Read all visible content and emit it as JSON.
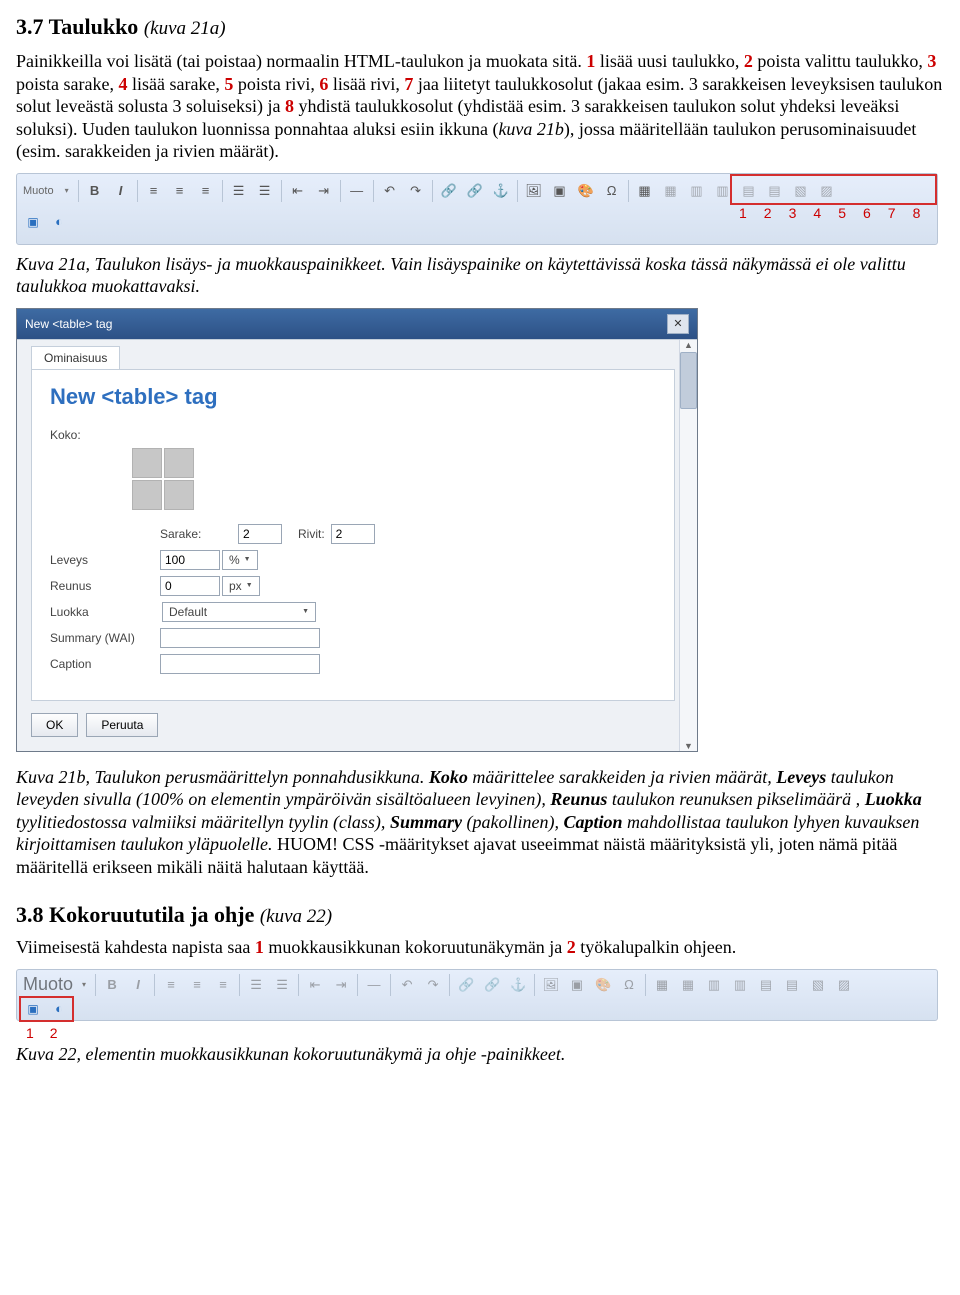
{
  "section37": {
    "title": "3.7 Taulukko",
    "kuva": "(kuva 21a)",
    "p1a": "Painikkeilla voi lisätä (tai poistaa) normaalin HTML-taulukon ja muokata sitä. ",
    "p1_1": "1",
    "p1_1t": " lisää uusi taulukko, ",
    "p1_2": "2",
    "p1_2t": " poista valittu taulukko, ",
    "p1_3": "3",
    "p1_3t": " poista sarake, ",
    "p1_4": "4",
    "p1_4t": " lisää sarake, ",
    "p1_5": "5",
    "p1_5t": " poista rivi, ",
    "p1_6": "6",
    "p1_6t": " lisää rivi, ",
    "p1_7": "7",
    "p1_7t": " jaa liitetyt taulukkosolut (jakaa esim. 3 sarakkeisen leveyksisen taulukon solut leveästä solusta 3 soluiseksi) ja ",
    "p1_8": "8",
    "p1_8t": " yhdistä taulukkosolut (yhdistää esim. 3 sarakkeisen taulukon solut yhdeksi leveäksi soluksi). Uuden taulukon luonnissa ponnahtaa aluksi esiin ikkuna (",
    "p1_8it": "kuva 21b",
    "p1_8end": "), jossa määritellään taulukon perusominaisuudet (esim. sarakkeiden ja rivien määrät)."
  },
  "toolbar": {
    "muoto": "Muoto",
    "nums": [
      "1",
      "2",
      "3",
      "4",
      "5",
      "6",
      "7",
      "8"
    ]
  },
  "cap21a": {
    "lead": "Kuva 21a, Taulukon lisäys- ja muokkauspainikkeet.",
    "rest": " Vain lisäyspainike on käytettävissä koska tässä näkymässä ei ole valittu taulukkoa muokattavaksi."
  },
  "dialog": {
    "title": "New <table> tag",
    "tab": "Ominaisuus",
    "heading": "New <table> tag",
    "koko": "Koko:",
    "sarake": "Sarake:",
    "sarake_v": "2",
    "rivit": "Rivit:",
    "rivit_v": "2",
    "leveys": "Leveys",
    "leveys_v": "100",
    "leveys_u": "%",
    "reunus": "Reunus",
    "reunus_v": "0",
    "reunus_u": "px",
    "luokka": "Luokka",
    "luokka_v": "Default",
    "summary": "Summary (WAI)",
    "caption": "Caption",
    "ok": "OK",
    "peruuta": "Peruuta"
  },
  "cap21b": {
    "lead": "Kuva 21b, Taulukon perusmäärittelyn ponnahdusikkuna.",
    "t1": " ",
    "koko_lbl": "Koko",
    "koko_txt": " määrittelee sarakkeiden ja rivien määrät, ",
    "leveys_lbl": "Leveys",
    "leveys_txt": " taulukon leveyden sivulla (100% on elementin ympäröivän sisältöalueen levyinen), ",
    "reunus_lbl": "Reunus",
    "reunus_txt": " taulukon reunuksen pikselimäärä , ",
    "luokka_lbl": "Luokka",
    "luokka_txt": " tyylitiedostossa valmiiksi määritellyn tyylin (class), ",
    "summary_lbl": "Summary",
    "summary_txt": " (pakollinen), ",
    "caption_lbl": "Caption",
    "caption_txt": " mahdollistaa taulukon lyhyen kuvauksen kirjoittamisen taulukon yläpuolelle.",
    "huom": " HUOM!",
    "tail": " CSS -määritykset ajavat useeimmat näistä määrityksistä yli, joten nämä pitää määritellä erikseen mikäli näitä halutaan käyttää."
  },
  "section38": {
    "title": "3.8 Kokoruututila ja ohje",
    "kuva": "(kuva 22)",
    "p1a": "Viimeisestä kahdesta napista saa ",
    "p1_1": "1",
    "p1_1t": " muokkausikkunan kokoruutunäkymän ja ",
    "p1_2": "2",
    "p1_2t": " työkalupalkin ohjeen."
  },
  "toolbar22nums": [
    "1",
    "2"
  ],
  "cap22": "Kuva 22, elementin muokkausikkunan kokoruutunäkymä ja ohje -painikkeet."
}
